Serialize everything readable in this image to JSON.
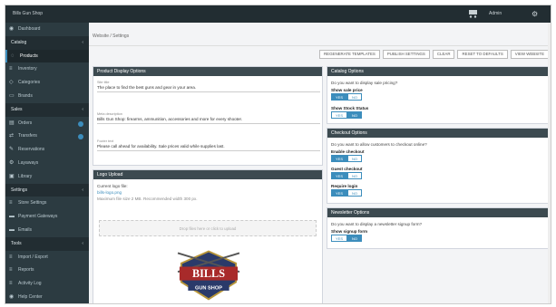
{
  "topbar": {
    "brand": "Bills Gun Shop",
    "user": "Admin"
  },
  "sidebar": {
    "items": [
      {
        "label": "Dashboard",
        "icon": "dashboard-icon",
        "glyph": "◉"
      },
      {
        "label": "Catalog",
        "icon": "catalog-header",
        "glyph": ""
      },
      {
        "label": "Products",
        "icon": "tag-icon",
        "glyph": "◌"
      },
      {
        "label": "Inventory",
        "icon": "list-icon",
        "glyph": "≡"
      },
      {
        "label": "Categories",
        "icon": "folder-icon",
        "glyph": "◇"
      },
      {
        "label": "Brands",
        "icon": "tag-icon",
        "glyph": "▭"
      },
      {
        "label": "Sales",
        "icon": "sales-header",
        "glyph": ""
      },
      {
        "label": "Orders",
        "icon": "cart-icon",
        "glyph": "▤"
      },
      {
        "label": "Transfers",
        "icon": "transfer-icon",
        "glyph": "⇄"
      },
      {
        "label": "Reservations",
        "icon": "clock-icon",
        "glyph": "✎"
      },
      {
        "label": "Layaways",
        "icon": "box-icon",
        "glyph": "⚙"
      },
      {
        "label": "Library",
        "icon": "library-icon",
        "glyph": "▣"
      },
      {
        "label": "Settings",
        "icon": "settings-header",
        "glyph": ""
      },
      {
        "label": "Store Settings",
        "icon": "list-icon",
        "glyph": "≡"
      },
      {
        "label": "Payment Gateways",
        "icon": "card-icon",
        "glyph": "▬"
      },
      {
        "label": "Emails",
        "icon": "mail-icon",
        "glyph": "▬"
      },
      {
        "label": "Tools",
        "icon": "tools-header",
        "glyph": ""
      },
      {
        "label": "Import / Export",
        "icon": "import-icon",
        "glyph": "≡"
      },
      {
        "label": "Reports",
        "icon": "report-icon",
        "glyph": "≡"
      },
      {
        "label": "Activity Log",
        "icon": "log-icon",
        "glyph": "≡"
      },
      {
        "label": "Help Center",
        "icon": "help-icon",
        "glyph": "◉"
      }
    ]
  },
  "breadcrumb": "Website / Settings",
  "toolbar": [
    "REGENERATE TEMPLATES",
    "PUBLISH SETTINGS",
    "CLEAR",
    "RESET TO DEFAULTS",
    "VIEW WEBSITE"
  ],
  "left_panel": {
    "title": "Product Display Options",
    "fields": [
      {
        "label": "Site title",
        "value": "The place to find the best guns and gear in your area."
      },
      {
        "label": "Meta description",
        "value": "Bills Gun Shop: firearms, ammunition, accessories and more for every shooter."
      },
      {
        "label": "Footer text",
        "value": "Please call ahead for availability. Sale prices valid while supplies last."
      }
    ]
  },
  "logo_panel": {
    "title": "Logo Upload",
    "current_label": "Current logo file:",
    "filename": "bills-logo.png",
    "note": "Maximum file size 2 MB. Recommended width 300 px.",
    "dropzone": "Drop files here or click to upload",
    "logo_text": [
      "BILLS",
      "GUN SHOP"
    ]
  },
  "display_panel": {
    "title": "Catalog Options",
    "question": "Do you want to display sale pricing?",
    "options": [
      {
        "label": "Show sale price",
        "on": "YES",
        "off": "NO"
      },
      {
        "label": "Show Stock Status",
        "on": "YES",
        "off": "NO"
      }
    ]
  },
  "checkout_panel": {
    "title": "Checkout Options",
    "question": "Do you want to allow customers to checkout online?",
    "options": [
      {
        "label": "Enable checkout",
        "on": "YES",
        "off": "NO"
      },
      {
        "label": "Guest checkout",
        "on": "YES",
        "off": "NO"
      },
      {
        "label": "Require login",
        "on": "YES",
        "off": "NO"
      }
    ]
  },
  "newsletter_panel": {
    "title": "Newsletter Options",
    "question": "Do you want to display a newsletter signup form?",
    "options": [
      {
        "label": "Show signup form",
        "on": "YES",
        "off": "NO"
      }
    ]
  },
  "colors": {
    "topbar": "#222d32",
    "sidebar": "#2c3b41",
    "accent": "#3c8dbc",
    "panel_header": "#3c4a50"
  }
}
